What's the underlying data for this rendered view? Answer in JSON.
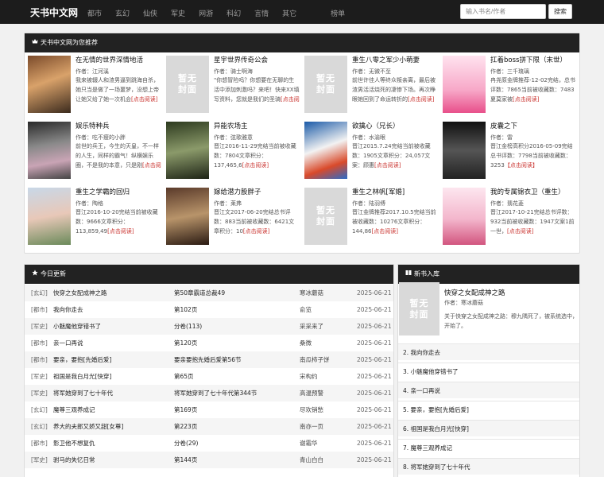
{
  "nav": {
    "brand": "天书中文网",
    "links": [
      "都市",
      "玄幻",
      "仙侠",
      "军史",
      "网游",
      "科幻",
      "言情",
      "其它"
    ],
    "rank": "榜单",
    "search_placeholder": "输入书名/作者",
    "search_button": "搜索"
  },
  "recommend": {
    "title": "天书中文网为您推荐",
    "icon": "crown-icon",
    "no_cover_line1": "暂无",
    "no_cover_line2": "封面",
    "books": [
      {
        "title": "在无情的世界深情地活",
        "author": "作者：江河溪",
        "desc": "我来被辍人和渣男逼到跳海自杀，她只当是做了一场噩梦，没想上帝让她又给了她一次机会",
        "more": "[点击阅读]",
        "cover": "cover"
      },
      {
        "title": "星宇世界传奇公会",
        "author": "作者：骑士啊海",
        "desc": "\"你想冒险吗？你想要在无聊的生活中添加刺激吗？来吧！快来XX填写资料，您就是我们的圣骑",
        "more": "[点击阅读]",
        "cover": "none"
      },
      {
        "title": "重生八零之军少小萌妻",
        "author": "作者：无微不至",
        "desc": "前世许佳人等终众叛亲离，最后被渣男活活烧死的凄惨下场。再次睁眼她回到了命运转折的",
        "more": "[点击阅读]",
        "cover": "none"
      },
      {
        "title": "扛着boss拼下限（末世）",
        "author": "作者：三千琉璃",
        "desc": "冉尧原金牌推荐-12-02完结，总书评数：7865当前被收藏数：7483夏莫家被",
        "more": "[点击阅读]",
        "cover": "cover"
      },
      {
        "title": "娱乐特种兵",
        "author": "作者：吃不瘦的小胖",
        "desc": "前世的兵王，今生的天皇，不一样的人生，同样的霸气！纵横娱乐圈，不是我的本意，只是刚",
        "more": "[点击阅读]",
        "cover": "cover"
      },
      {
        "title": "异能农场主",
        "author": "作者：弦歌雅意",
        "desc": "晋江2016-11-29完结当前被收藏数：7804文章积分：137,465,6",
        "more": "[点击阅读]",
        "cover": "cover"
      },
      {
        "title": "欲擒心（兄长）",
        "author": "作者：水渝眼",
        "desc": "晋江2015.7.24完结当前被收藏数：1905文章积分：24,057文案：顾惠",
        "more": "[点击阅读]",
        "cover": "cover"
      },
      {
        "title": "皮囊之下",
        "author": "作者：雷",
        "desc": "晋江金榜高积分2016-05-09完结总书评数：7798当前被收藏数：3253",
        "more": "【点击阅读】",
        "cover": "cover"
      },
      {
        "title": "重生之学霸的回归",
        "author": "作者：陶格",
        "desc": "晋江2016-10-20完结当前被收藏数：9666文章积分：113,859,49",
        "more": "[点击阅读]",
        "cover": "cover"
      },
      {
        "title": "嫁给潜力股胖子",
        "author": "作者：莱弗",
        "desc": "晋江文2017-06-20完结总书评数：883当前被收藏数：6421文章积分：10",
        "more": "[点击阅读]",
        "cover": "cover"
      },
      {
        "title": "重生之林帆[军婚]",
        "author": "作者：陆羽傅",
        "desc": "晋江金牌推荐2017.10.5完结当前被收藏数：10276文章积分：144,86",
        "more": "[点击阅读]",
        "cover": "none"
      },
      {
        "title": "我的专属锦衣卫（重生）",
        "author": "作者：翡花菱",
        "desc": "晋江2017-10-21完结总书评数：932当前被收藏数：1947文案1前一世，",
        "more": "[点击阅读]",
        "cover": "cover"
      }
    ]
  },
  "today": {
    "title": "今日更新",
    "icon": "star-icon",
    "rows": [
      {
        "cat": "[玄幻]",
        "book": "快穿之女配成神之路",
        "chapter": "第50章霸道总裁49",
        "author": "寒冰蘑菇",
        "date": "2025-06-21"
      },
      {
        "cat": "[都市]",
        "book": "我向你走去",
        "chapter": "第102页",
        "author": "俞览",
        "date": "2025-06-21"
      },
      {
        "cat": "[军史]",
        "book": "小魅魔他穿错书了",
        "chapter": "分卷(113)",
        "author": "采采来了",
        "date": "2025-06-21"
      },
      {
        "cat": "[都市]",
        "book": "亲一口再说",
        "chapter": "第120页",
        "author": "桑微",
        "date": "2025-06-21"
      },
      {
        "cat": "[都市]",
        "book": "要亲，要抱[先婚后爱]",
        "chapter": "要亲要抱先婚后爱第56节",
        "author": "南瓜柿子饼",
        "date": "2025-06-21"
      },
      {
        "cat": "[军史]",
        "book": "祖国是我白月光[快穿]",
        "chapter": "第65页",
        "author": "宋构约",
        "date": "2025-06-21"
      },
      {
        "cat": "[军史]",
        "book": "将军她穿到了七十年代",
        "chapter": "将军她穿到了七十年代第344节",
        "author": "高温预警",
        "date": "2025-06-21"
      },
      {
        "cat": "[玄幻]",
        "book": "魔尊三观养成记",
        "chapter": "第169页",
        "author": "尽欢销愁",
        "date": "2025-06-21"
      },
      {
        "cat": "[玄幻]",
        "book": "养大的夫郎又娇又甜[女尊]",
        "chapter": "第223页",
        "author": "南亦一页",
        "date": "2025-06-21"
      },
      {
        "cat": "[都市]",
        "book": "影卫他不想复仇",
        "chapter": "分卷(29)",
        "author": "谢霜华",
        "date": "2025-06-21"
      },
      {
        "cat": "[军史]",
        "book": "驸马的失忆日常",
        "chapter": "第144页",
        "author": "青山白白",
        "date": "2025-06-21"
      }
    ]
  },
  "newbooks": {
    "title": "新书入库",
    "icon": "book-icon",
    "featured": {
      "title": "快穿之女配成神之路",
      "author": "作者：寒冰蘑菇",
      "desc": "关于快穿之女配成神之路：穆九隅死了，被系统选中，开始了。"
    },
    "items": [
      "2. 我向你走去",
      "3. 小魅魔他穿错书了",
      "4. 亲一口再说",
      "5. 要亲，要抱[先婚后爱]",
      "6. 祖国是我白月光[快穿]",
      "7. 魔尊三观养成记",
      "8. 将军她穿到了七十年代"
    ]
  }
}
